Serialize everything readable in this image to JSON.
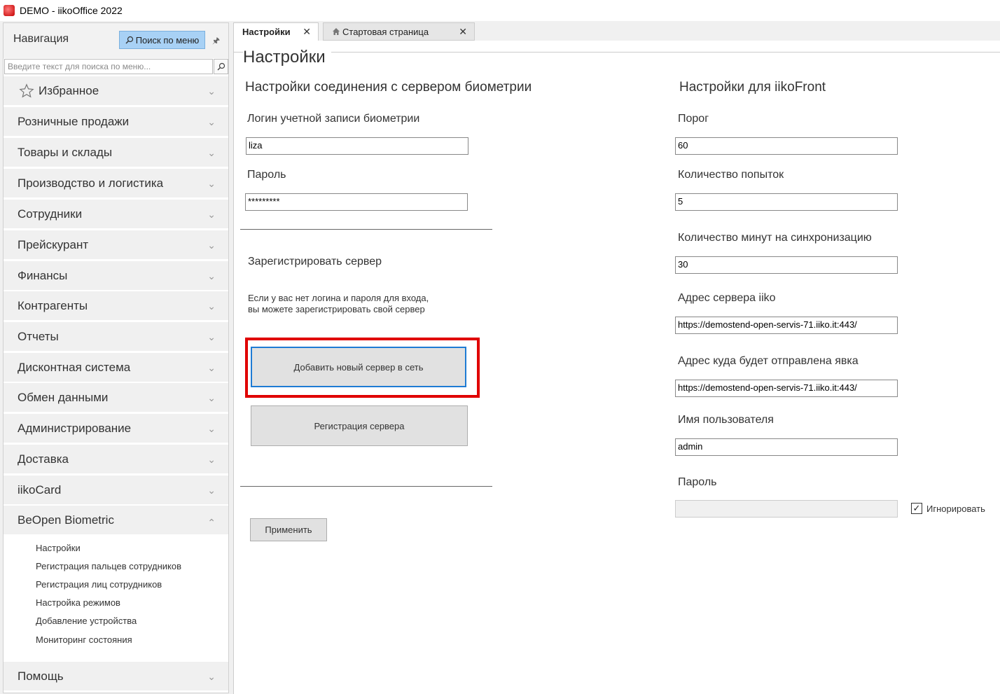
{
  "window": {
    "title": "DEMO - iikoOffice 2022",
    "icon": "app-logo-icon"
  },
  "navigation": {
    "title": "Навигация",
    "search_button": "Поиск по меню",
    "search_placeholder": "Введите текст для поиска по меню...",
    "sections": [
      {
        "label": "Избранное"
      },
      {
        "label": "Розничные продажи"
      },
      {
        "label": "Товары и склады"
      },
      {
        "label": "Производство и логистика"
      },
      {
        "label": "Сотрудники"
      },
      {
        "label": "Прейскурант"
      },
      {
        "label": "Финансы"
      },
      {
        "label": "Контрагенты"
      },
      {
        "label": "Отчеты"
      },
      {
        "label": "Дисконтная система"
      },
      {
        "label": "Обмен данными"
      },
      {
        "label": "Администрирование"
      },
      {
        "label": "Доставка"
      },
      {
        "label": "iikoCard"
      },
      {
        "label": "BeOpen Biometric"
      },
      {
        "label": "Помощь"
      }
    ],
    "expanded_section_items": [
      "Настройки",
      "Регистрация пальцев сотрудников",
      "Регистрация лиц сотрудников",
      "Настройка режимов",
      "Добавление устройства",
      "Мониторинг состояния"
    ]
  },
  "tabs": [
    {
      "label": "Настройки",
      "active": true
    },
    {
      "label": "Стартовая страница",
      "active": false
    }
  ],
  "page": {
    "title": "Настройки",
    "biometric": {
      "title": "Настройки соединения с сервером биометрии",
      "login_label": "Логин учетной записи биометрии",
      "login_value": "liza",
      "password_label": "Пароль",
      "password_value": "*********",
      "register_title": "Зарегистрировать сервер",
      "register_hint_1": "Если у вас нет логина и пароля для входа,",
      "register_hint_2": "вы можете зарегистрировать свой сервер",
      "add_server_button": "Добавить новый сервер в сеть",
      "register_server_button": "Регистрация сервера",
      "apply_button": "Применить"
    },
    "iikofront": {
      "title": "Настройки для iikoFront",
      "threshold_label": "Порог",
      "threshold_value": "60",
      "attempts_label": "Количество попыток",
      "attempts_value": "5",
      "sync_minutes_label": "Количество минут на синхронизацию",
      "sync_minutes_value": "30",
      "server_address_label": "Адрес сервера iiko",
      "server_address_value": "https://demostend-open-servis-71.iiko.it:443/",
      "attendance_address_label": "Адрес куда будет отправлена явка",
      "attendance_address_value": "https://demostend-open-servis-71.iiko.it:443/",
      "username_label": "Имя пользователя",
      "username_value": "admin",
      "password_label": "Пароль",
      "password_value": "",
      "ignore_label": "Игнорировать",
      "ignore_checked": true
    }
  },
  "colors": {
    "highlight": "#e00000",
    "search_button_bg": "#a8d1f5",
    "focus_border": "#1e7bd4"
  }
}
